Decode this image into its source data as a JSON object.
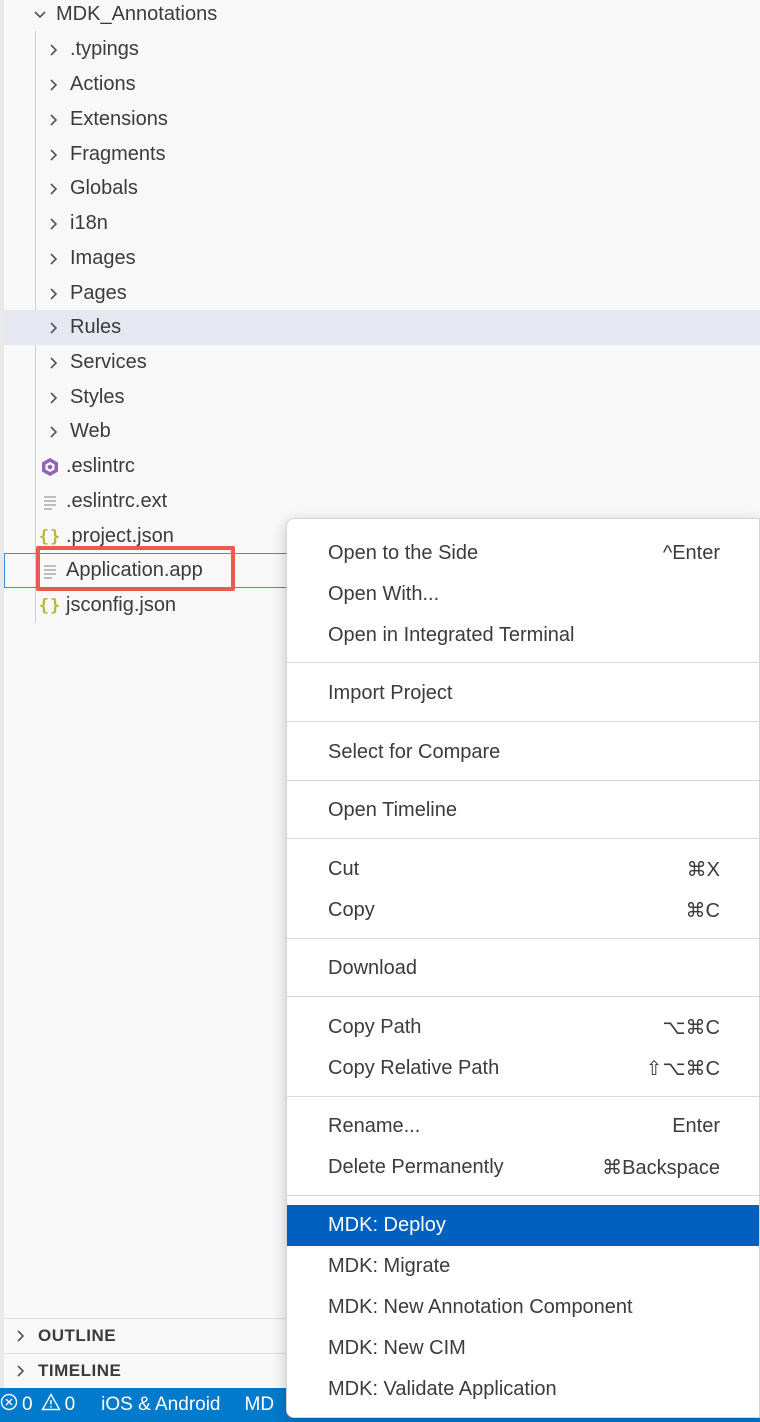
{
  "explorer": {
    "root": {
      "label": "MDK_Annotations"
    },
    "folders": [
      {
        "label": ".typings"
      },
      {
        "label": "Actions"
      },
      {
        "label": "Extensions"
      },
      {
        "label": "Fragments"
      },
      {
        "label": "Globals"
      },
      {
        "label": "i18n"
      },
      {
        "label": "Images"
      },
      {
        "label": "Pages"
      },
      {
        "label": "Rules"
      },
      {
        "label": "Services"
      },
      {
        "label": "Styles"
      },
      {
        "label": "Web"
      }
    ],
    "files": [
      {
        "label": ".eslintrc",
        "icon": "eslint-icon"
      },
      {
        "label": ".eslintrc.ext",
        "icon": "file-lines-icon"
      },
      {
        "label": ".project.json",
        "icon": "json-braces-icon"
      },
      {
        "label": "Application.app",
        "icon": "file-lines-icon"
      },
      {
        "label": "jsconfig.json",
        "icon": "json-braces-icon"
      }
    ],
    "json_glyph": "{}"
  },
  "panels": {
    "outline": "OUTLINE",
    "timeline": "TIMELINE"
  },
  "statusbar": {
    "errors": "0",
    "warnings": "0",
    "platform": "iOS & Android",
    "mdk": "MD"
  },
  "context_menu": {
    "items": [
      {
        "label": "Open to the Side",
        "shortcut": "^Enter"
      },
      {
        "label": "Open With...",
        "shortcut": ""
      },
      {
        "label": "Open in Integrated Terminal",
        "shortcut": ""
      },
      {
        "label": "Import Project",
        "shortcut": ""
      },
      {
        "label": "Select for Compare",
        "shortcut": ""
      },
      {
        "label": "Open Timeline",
        "shortcut": ""
      },
      {
        "label": "Cut",
        "shortcut": "⌘X"
      },
      {
        "label": "Copy",
        "shortcut": "⌘C"
      },
      {
        "label": "Download",
        "shortcut": ""
      },
      {
        "label": "Copy Path",
        "shortcut": "⌥⌘C"
      },
      {
        "label": "Copy Relative Path",
        "shortcut": "⇧⌥⌘C"
      },
      {
        "label": "Rename...",
        "shortcut": "Enter"
      },
      {
        "label": "Delete Permanently",
        "shortcut": "⌘Backspace"
      },
      {
        "label": "MDK: Deploy",
        "shortcut": ""
      },
      {
        "label": "MDK: Migrate",
        "shortcut": ""
      },
      {
        "label": "MDK: New Annotation Component",
        "shortcut": ""
      },
      {
        "label": "MDK: New CIM",
        "shortcut": ""
      },
      {
        "label": "MDK: Validate Application",
        "shortcut": ""
      }
    ],
    "active_item": "MDK: Deploy"
  },
  "colors": {
    "statusbar": "#007acc",
    "menu_highlight": "#0060c0",
    "annotation_box": "#ea5a4e",
    "hover_row": "#e5e7f1"
  }
}
